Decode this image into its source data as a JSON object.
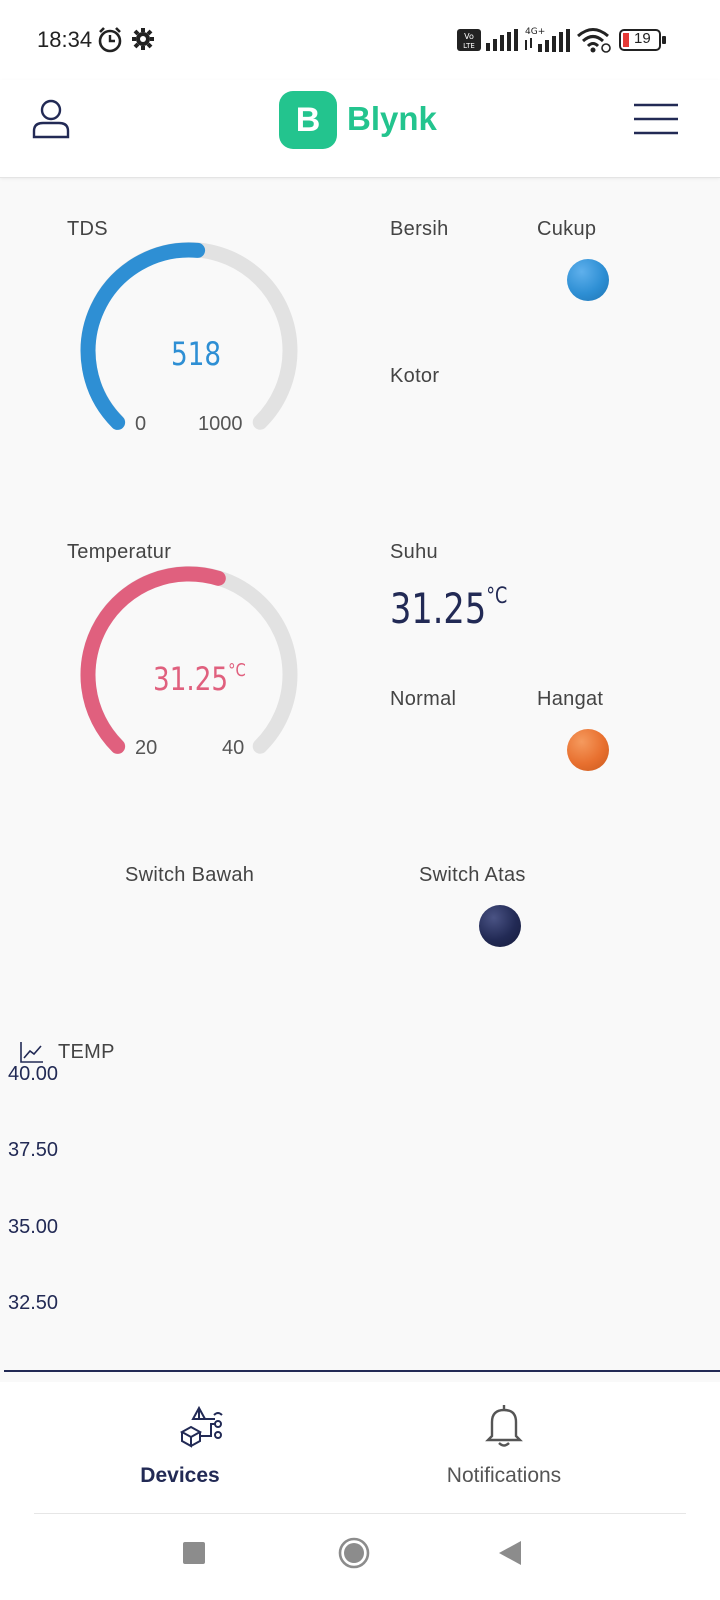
{
  "status_bar": {
    "time": "18:34",
    "battery": "19",
    "network": "4G+",
    "icons": [
      "alarm-icon",
      "gear-icon",
      "volte-icon",
      "signal-icon",
      "wifi-icon",
      "battery-icon"
    ]
  },
  "header": {
    "logo_letter": "B",
    "brand": "Blynk",
    "icons": [
      "user-icon",
      "menu-icon"
    ],
    "brand_color": "#23c48e"
  },
  "dashboard": {
    "tds": {
      "title": "TDS",
      "value": "518",
      "min": "0",
      "max": "1000",
      "fraction": 0.518,
      "color": "#2e8fd4"
    },
    "led_group1": {
      "label_a": "Bersih",
      "label_b": "Cukup",
      "label_c": "Kotor",
      "led_color": "#2e8fd4"
    },
    "temp": {
      "title": "Temperatur",
      "value": "31.25",
      "unit": "°C",
      "min": "20",
      "max": "40",
      "fraction": 0.5625,
      "color": "#e0607e"
    },
    "suhu": {
      "title": "Suhu",
      "value": "31.25",
      "unit": "°C"
    },
    "led_group2": {
      "label_a": "Normal",
      "label_b": "Hangat",
      "led_color": "#e8702f"
    },
    "switch_bawah": {
      "title": "Switch Bawah"
    },
    "switch_atas": {
      "title": "Switch Atas",
      "led_color": "#222a55"
    },
    "chart": {
      "title": "TEMP",
      "y_ticks": [
        "40.00",
        "37.50",
        "35.00",
        "32.50"
      ]
    }
  },
  "bottom_nav": {
    "devices": "Devices",
    "notifications": "Notifications"
  },
  "system_nav": [
    "recents-icon",
    "home-icon",
    "back-icon"
  ]
}
